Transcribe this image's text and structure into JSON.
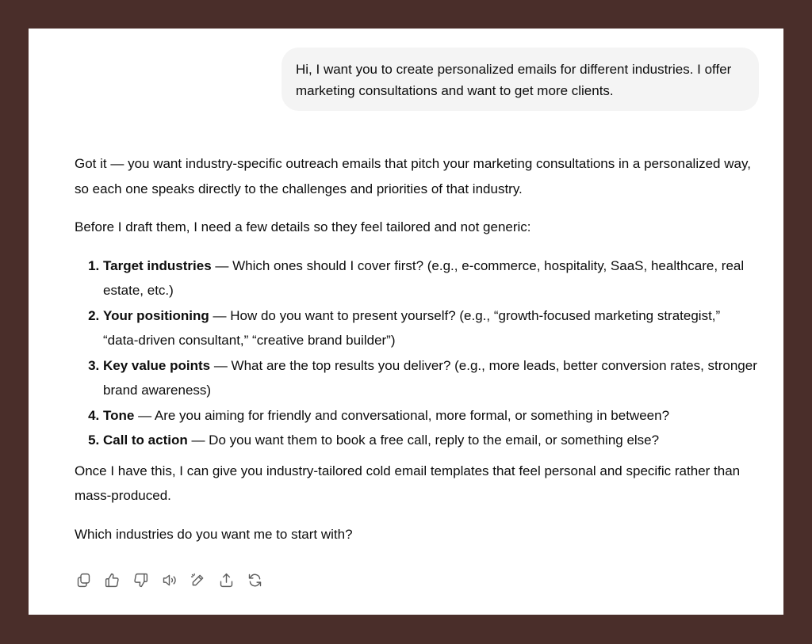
{
  "user_message": "Hi, I want you to create personalized emails for different industries. I offer marketing consultations and want to get more clients.",
  "assistant": {
    "intro": "Got it — you want industry-specific outreach emails that pitch your marketing consultations in a personalized way, so each one speaks directly to the challenges and priorities of that industry.",
    "lead": "Before I draft them, I need a few details so they feel tailored and not generic:",
    "list": [
      {
        "title": "Target industries",
        "text": " — Which ones should I cover first? (e.g., e-commerce, hospitality, SaaS, healthcare, real estate, etc.)"
      },
      {
        "title": "Your positioning",
        "text": " — How do you want to present yourself? (e.g., “growth-focused marketing strategist,” “data-driven consultant,” “creative brand builder”)"
      },
      {
        "title": "Key value points",
        "text": " — What are the top results you deliver? (e.g., more leads, better conversion rates, stronger brand awareness)"
      },
      {
        "title": "Tone",
        "text": " — Are you aiming for friendly and conversational, more formal, or something in between?"
      },
      {
        "title": "Call to action",
        "text": " — Do you want them to book a free call, reply to the email, or something else?"
      }
    ],
    "closing": "Once I have this, I can give you industry-tailored cold email templates that feel personal and specific rather than mass-produced.",
    "question": "Which industries do you want me to start with?"
  },
  "actions": [
    "copy-icon",
    "thumbs-up-icon",
    "thumbs-down-icon",
    "read-aloud-icon",
    "edit-icon",
    "share-icon",
    "regenerate-icon"
  ],
  "colors": {
    "background": "#4a2e2a",
    "panel": "#ffffff",
    "bubble": "#f4f4f4",
    "text": "#0d0d0d",
    "icon": "#5d5d5d"
  }
}
